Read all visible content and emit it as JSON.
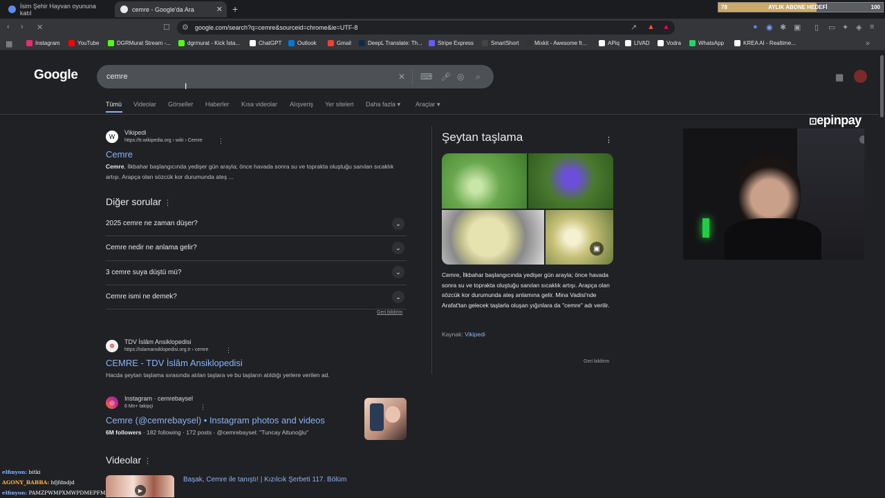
{
  "browser": {
    "tabs": [
      {
        "label": "İsim Şehir Hayvan oyununa katıl",
        "active": false
      },
      {
        "label": "cemre - Google'da Ara",
        "active": true
      }
    ],
    "new_tab": "+",
    "url": "google.com/search?q=cemre&sourceid=chrome&ie=UTF-8",
    "bookmarks": [
      {
        "label": "Instagram",
        "color": "#e1306c"
      },
      {
        "label": "YouTube",
        "color": "#ff0000"
      },
      {
        "label": "DGRMurat Stream -...",
        "color": "#53fc18"
      },
      {
        "label": "dgrmurat - Kick İsta...",
        "color": "#53fc18"
      },
      {
        "label": "ChatGPT",
        "color": "#ffffff"
      },
      {
        "label": "Outlook",
        "color": "#0078d4"
      },
      {
        "label": "Gmail",
        "color": "#ea4335"
      },
      {
        "label": "DeepL Translate: Th...",
        "color": "#0f2b46"
      },
      {
        "label": "Stripe Express",
        "color": "#635bff"
      },
      {
        "label": "SmartShort",
        "color": "#444444"
      },
      {
        "label": "Mixkit - Awesome fr...",
        "color": "#333333"
      },
      {
        "label": "APiq",
        "color": "#ffffff"
      },
      {
        "label": "LIVAD",
        "color": "#ffffff"
      },
      {
        "label": "Vodra",
        "color": "#ffffff"
      },
      {
        "label": "WhatsApp",
        "color": "#25d366"
      },
      {
        "label": "KREA AI - Realtime...",
        "color": "#ffffff"
      }
    ]
  },
  "subscriber_goal": {
    "current": "78",
    "label": "AYLIK ABONE HEDEFİ",
    "target": "100",
    "progress": 0.78
  },
  "google": {
    "logo": "Google",
    "query": "cemre",
    "tabs": [
      "Tümü",
      "Videolar",
      "Görseller",
      "Haberler",
      "Kısa videolar",
      "Alışveriş",
      "Yer siteleri",
      "Daha fazla",
      "Araçlar"
    ],
    "results": [
      {
        "source": "Vikipedi",
        "url": "https://tr.wikipedia.org › wiki › Cemre",
        "title": "Cemre",
        "snippet_bold": "Cemre",
        "snippet": ", İlkbahar başlangıcında yedişer gün arayla; önce havada sonra su ve toprakta oluştuğu sanılan sıcaklık artışı. Arapça olan sözcük kor durumunda ateş ..."
      },
      {
        "source": "TDV İslâm Ansiklopedisi",
        "url": "https://islamansiklopedisi.org.tr › cemre",
        "title": "CEMRE - TDV İslâm Ansiklopedisi",
        "snippet": "Hacda şeytan taşlama sırasında atılan taşlara ve bu taşların atıldığı yerlere verilen ad."
      },
      {
        "source": "Instagram · cemrebaysel",
        "followers_line": "6 Mn+ takipçi",
        "title": "Cemre (@cemrebaysel) • Instagram photos and videos",
        "stats_bold": "6M followers",
        "stats": " · 182 following · 172 posts · @cemrebaysel: \"Tuncay Altunoğlu\""
      }
    ],
    "paa": {
      "heading": "Diğer sorular",
      "questions": [
        "2025 cemre ne zaman düşer?",
        "Cemre nedir ne anlama gelir?",
        "3 cemre suya düştü mü?",
        "Cemre ismi ne demek?"
      ],
      "feedback": "Geri bildirim"
    },
    "videos": {
      "heading": "Videolar",
      "first_title": "Başak, Cemre ile tanıştı! | Kızılcık Şerbeti 117. Bölüm"
    },
    "knowledge_panel": {
      "title": "Şeytan taşlama",
      "description": "Cemre, İlkbahar başlangıcında yedişer gün arayla; önce havada sonra su ve toprakta oluştuğu sanılan sıcaklık artışı. Arapça olan sözcük kor durumunda ateş anlamına gelir. Mina Vadisi'nde Arafat'tan gelecek taşlarla oluşan yığınlara da \"cemre\" adı verilir.",
      "source_label": "Kaynak:",
      "source_link": "Vikipedi",
      "feedback": "Geri bildirim"
    }
  },
  "overlay": {
    "sponsor": "epinpay",
    "chat": [
      {
        "user": "elfinyon:",
        "msg": " bitki"
      },
      {
        "user": "AGONY_BABBA:",
        "msg": " hfjfdndjd"
      },
      {
        "user": "elfinyon:",
        "msg": " PAMZPWMPXMWPDMEPFM"
      }
    ]
  },
  "colors": {
    "link": "#8ab4f8",
    "bg": "#202124",
    "searchbox": "#4d5156"
  }
}
